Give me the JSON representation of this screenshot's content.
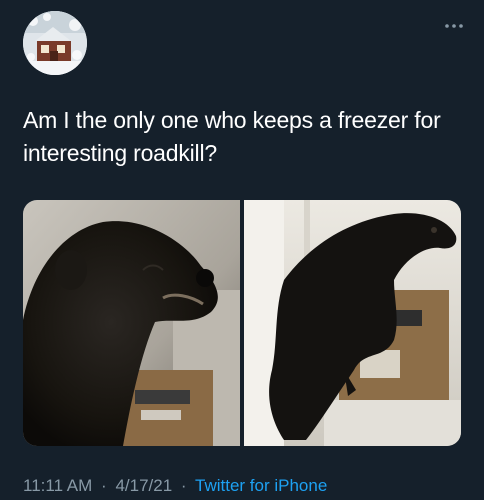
{
  "tweet": {
    "text": "Am I the only one who keeps a freezer for interesting roadkill?",
    "media": [
      {
        "description": "close-up-of-frozen-fisher-head"
      },
      {
        "description": "frozen-fisher-in-freezer-bin"
      }
    ]
  },
  "meta": {
    "time": "11:11 AM",
    "separator": "·",
    "date": "4/17/21",
    "source": "Twitter for iPhone"
  },
  "icons": {
    "more": "more-horizontal-icon",
    "avatar": "avatar"
  },
  "colors": {
    "background": "#15202b",
    "text": "#ffffff",
    "secondary_text": "#8899a6",
    "link": "#1da1f2"
  }
}
